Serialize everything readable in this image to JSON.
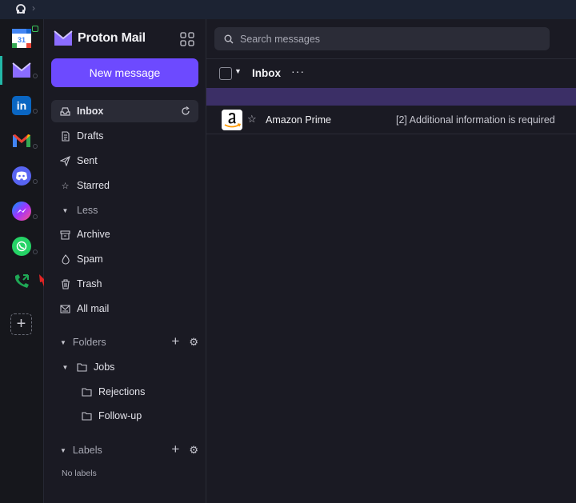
{
  "rail": {
    "items": [
      {
        "name": "Google Calendar",
        "icon": "calendar-icon",
        "label": "31"
      },
      {
        "name": "Proton Mail",
        "icon": "proton-mail-icon",
        "label": "M"
      },
      {
        "name": "LinkedIn",
        "icon": "linkedin-icon",
        "label": "in"
      },
      {
        "name": "Gmail",
        "icon": "gmail-icon",
        "label": "M"
      },
      {
        "name": "Discord",
        "icon": "discord-icon",
        "label": ""
      },
      {
        "name": "Messenger",
        "icon": "messenger-icon",
        "label": ""
      },
      {
        "name": "WhatsApp",
        "icon": "whatsapp-icon",
        "label": ""
      },
      {
        "name": "Phone",
        "icon": "phone-icon",
        "label": ""
      }
    ],
    "add_label": "+"
  },
  "brand": {
    "name": "Proton Mail"
  },
  "sidebar": {
    "new_message": "New message",
    "nav": [
      {
        "label": "Inbox",
        "icon": "inbox-icon"
      },
      {
        "label": "Drafts",
        "icon": "drafts-icon"
      },
      {
        "label": "Sent",
        "icon": "sent-icon"
      },
      {
        "label": "Starred",
        "icon": "star-icon"
      },
      {
        "label": "Less",
        "icon": "chevron-down-icon"
      },
      {
        "label": "Archive",
        "icon": "archive-icon"
      },
      {
        "label": "Spam",
        "icon": "spam-icon"
      },
      {
        "label": "Trash",
        "icon": "trash-icon"
      },
      {
        "label": "All mail",
        "icon": "all-mail-icon"
      }
    ],
    "folders_title": "Folders",
    "folders": [
      {
        "label": "Jobs"
      },
      {
        "label": "Rejections"
      },
      {
        "label": "Follow-up"
      }
    ],
    "labels_title": "Labels",
    "no_labels": "No labels"
  },
  "main": {
    "search_placeholder": "Search messages",
    "folder_title": "Inbox",
    "more": "···",
    "messages": [
      {
        "sender": "Amazon Prime",
        "subject": "[2] Additional information is required",
        "avatar": "amazon-logo-icon"
      }
    ]
  },
  "colors": {
    "accent": "#6d4aff",
    "rail_active": "#22b8a8",
    "banner": "#3b2f66"
  }
}
